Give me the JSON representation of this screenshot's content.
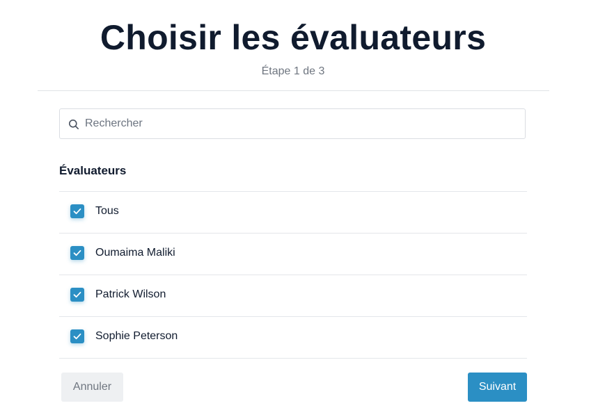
{
  "header": {
    "title": "Choisir les évaluateurs",
    "step": "Étape 1 de 3"
  },
  "search": {
    "placeholder": "Rechercher",
    "value": "",
    "icon": "search-icon"
  },
  "reviewers": {
    "section_title": "Évaluateurs",
    "items": [
      {
        "label": "Tous",
        "checked": true
      },
      {
        "label": "Oumaima Maliki",
        "checked": true
      },
      {
        "label": "Patrick Wilson",
        "checked": true
      },
      {
        "label": "Sophie Peterson",
        "checked": true
      }
    ]
  },
  "footer": {
    "cancel_label": "Annuler",
    "next_label": "Suivant"
  },
  "colors": {
    "accent": "#2b8fc4",
    "title": "#101b2e",
    "muted": "#6f7680",
    "divider": "#e3e6ea",
    "cancel_bg": "#eef0f2"
  }
}
